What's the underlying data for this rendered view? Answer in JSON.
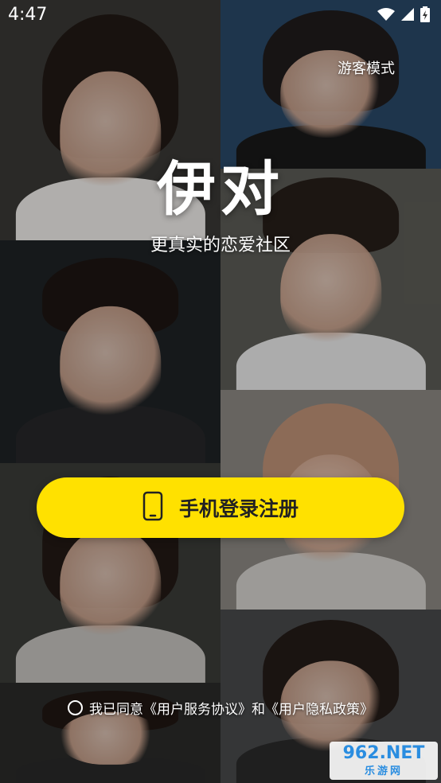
{
  "status_bar": {
    "time": "4:47"
  },
  "header": {
    "guest_mode_label": "游客模式"
  },
  "brand": {
    "logo_text": "伊对",
    "slogan": "更真实的恋爱社区"
  },
  "login": {
    "button_label": "手机登录注册",
    "button_color": "#FFE100",
    "icon": "mobile-phone-icon"
  },
  "agreement": {
    "prefix": "我已同意",
    "terms_link": "《用户服务协议》",
    "conjunction": "和",
    "privacy_link": "《用户隐私政策》"
  },
  "watermark": {
    "brand": "962",
    "suffix": ".NET",
    "subtitle": "乐游网"
  },
  "photos": [
    {
      "name": "photo-woman-top-left",
      "bg": "#3b3a36",
      "shirt": "#f4f2ef"
    },
    {
      "name": "photo-woman-top-right",
      "bg": "#2a4a6a",
      "shirt": "#1a1a1a"
    },
    {
      "name": "photo-man-car",
      "bg": "#1f2326",
      "shirt": "#27282a"
    },
    {
      "name": "photo-man-street",
      "bg": "#5e5e58",
      "shirt": "#efefef"
    },
    {
      "name": "photo-woman-beret",
      "bg": "#8f8b86",
      "shirt": "#d9d6d1"
    },
    {
      "name": "photo-woman-flowers",
      "bg": "#3c3d3a",
      "shirt": "#c9c6c2"
    },
    {
      "name": "photo-woman-bottom-right",
      "bg": "#4a4b4d",
      "shirt": "#2b2b2b"
    },
    {
      "name": "photo-man-bottom-left",
      "bg": "#2c2c2a",
      "shirt": "#2a2a2a"
    }
  ]
}
